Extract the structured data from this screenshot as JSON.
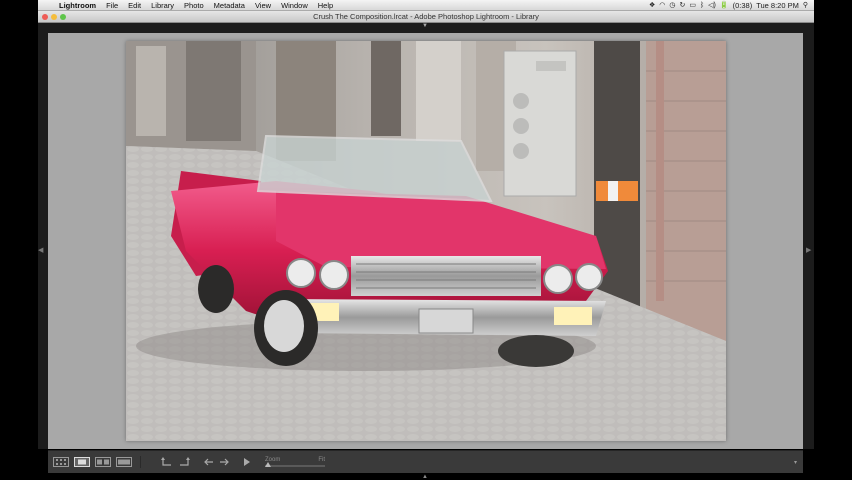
{
  "menubar": {
    "apple_icon": "",
    "items": [
      "Lightroom",
      "File",
      "Edit",
      "Library",
      "Photo",
      "Metadata",
      "View",
      "Window",
      "Help"
    ],
    "status_icons": [
      "dropbox-icon",
      "wifi-icon",
      "clock-icon",
      "sync-icon",
      "display-icon",
      "bluetooth-icon",
      "volume-icon"
    ],
    "battery": "(0:38)",
    "battery_icon": "🔋",
    "clock": "Tue 8:20 PM",
    "spotlight_icon": "⚲"
  },
  "window": {
    "title": "Crush The Composition.lrcat - Adobe Photoshop Lightroom - Library"
  },
  "panel_toggles": {
    "top": "▼",
    "bottom": "▲",
    "left": "◀",
    "right": "▶"
  },
  "toolbar": {
    "zoom_label": "Zoom",
    "zoom_value": "Fit",
    "menu_icon": "▾"
  }
}
